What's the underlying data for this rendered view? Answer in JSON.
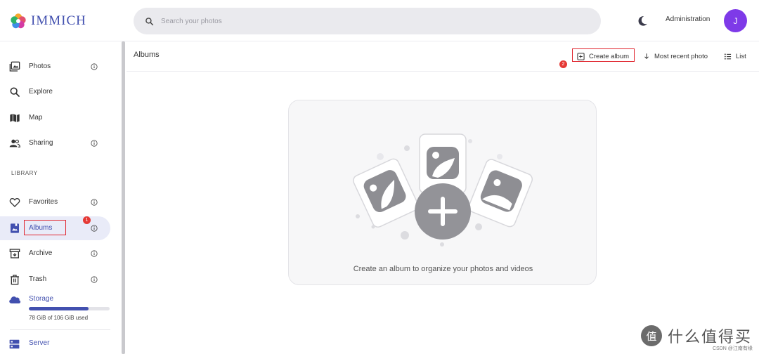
{
  "header": {
    "logo_text": "IMMICH",
    "search_placeholder": "Search your photos",
    "admin_label": "Administration",
    "avatar_initial": "J"
  },
  "sidebar": {
    "items": [
      {
        "label": "Photos",
        "icon": "photos-icon"
      },
      {
        "label": "Explore",
        "icon": "search-icon"
      },
      {
        "label": "Map",
        "icon": "map-icon"
      },
      {
        "label": "Sharing",
        "icon": "people-icon"
      }
    ],
    "library_label": "LIBRARY",
    "library_items": [
      {
        "label": "Favorites",
        "icon": "heart-icon"
      },
      {
        "label": "Albums",
        "icon": "album-icon",
        "active": true,
        "badge": "1"
      },
      {
        "label": "Archive",
        "icon": "archive-icon"
      },
      {
        "label": "Trash",
        "icon": "trash-icon"
      }
    ],
    "storage": {
      "title": "Storage",
      "usage_text": "78 GiB of 106 GiB used",
      "used_fraction": 0.74
    },
    "server_title": "Server"
  },
  "main": {
    "title": "Albums",
    "create_album_label": "Create album",
    "create_badge": "2",
    "sort_label": "Most recent photo",
    "view_label": "List",
    "empty_text": "Create an album to organize your photos and videos"
  },
  "watermark": {
    "logo_char": "值",
    "text": "什么值得买",
    "sub": "CSDN @江南有缘"
  },
  "colors": {
    "accent": "#4250af",
    "avatar": "#7e3ae8",
    "highlight_box": "#e0262f",
    "badge": "#e53935"
  }
}
